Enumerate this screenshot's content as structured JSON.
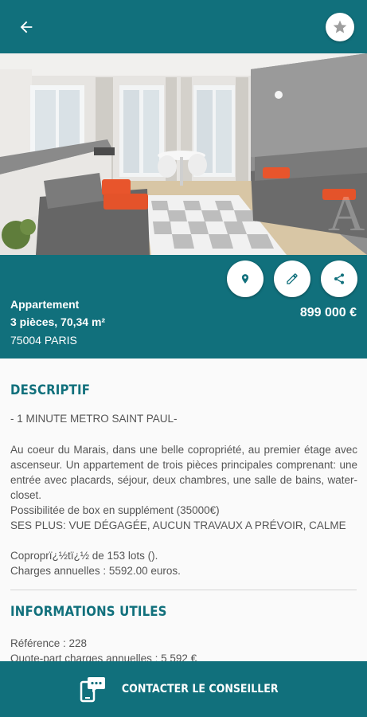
{
  "colors": {
    "brand": "#11707c",
    "accent_text": "#11707c",
    "star": "#9e9e9e"
  },
  "header": {
    "back_icon": "arrow-left-icon",
    "favorite_icon": "star-icon"
  },
  "photo": {
    "watermark": "A"
  },
  "actions": [
    {
      "name": "location-button",
      "icon": "map-pin-icon"
    },
    {
      "name": "edit-button",
      "icon": "pencil-icon"
    },
    {
      "name": "share-button",
      "icon": "share-icon"
    }
  ],
  "listing": {
    "type": "Appartement",
    "rooms_area": "3 pièces, 70,34 m²",
    "city": "75004 PARIS",
    "price": "899 000 €"
  },
  "descriptif": {
    "title": "DESCRIPTIF",
    "headline": "- 1 MINUTE METRO SAINT PAUL-",
    "paragraph": "Au coeur du Marais, dans une belle copropriété, au premier étage avec ascenseur. Un appartement de trois pièces principales comprenant: une entrée avec placards, séjour, deux chambres, une salle de bains, water-closet.",
    "box": "Possibilitée de box en supplément (35000€)",
    "plus": "SES PLUS: VUE DÉGAGÉE, AUCUN TRAVAUX A PRÉVOIR, CALME",
    "copro": "Coproprï¿½tï¿½ de 153 lots ().",
    "charges": "Charges annuelles : 5592.00 euros."
  },
  "infos": {
    "title": "INFORMATIONS UTILES",
    "reference": "Référence : 228",
    "quote_part": "Quote-part charges annuelles : 5 592 €"
  },
  "footer": {
    "contact_label": "CONTACTER LE CONSEILLER",
    "contact_icon": "chat-phone-icon"
  }
}
